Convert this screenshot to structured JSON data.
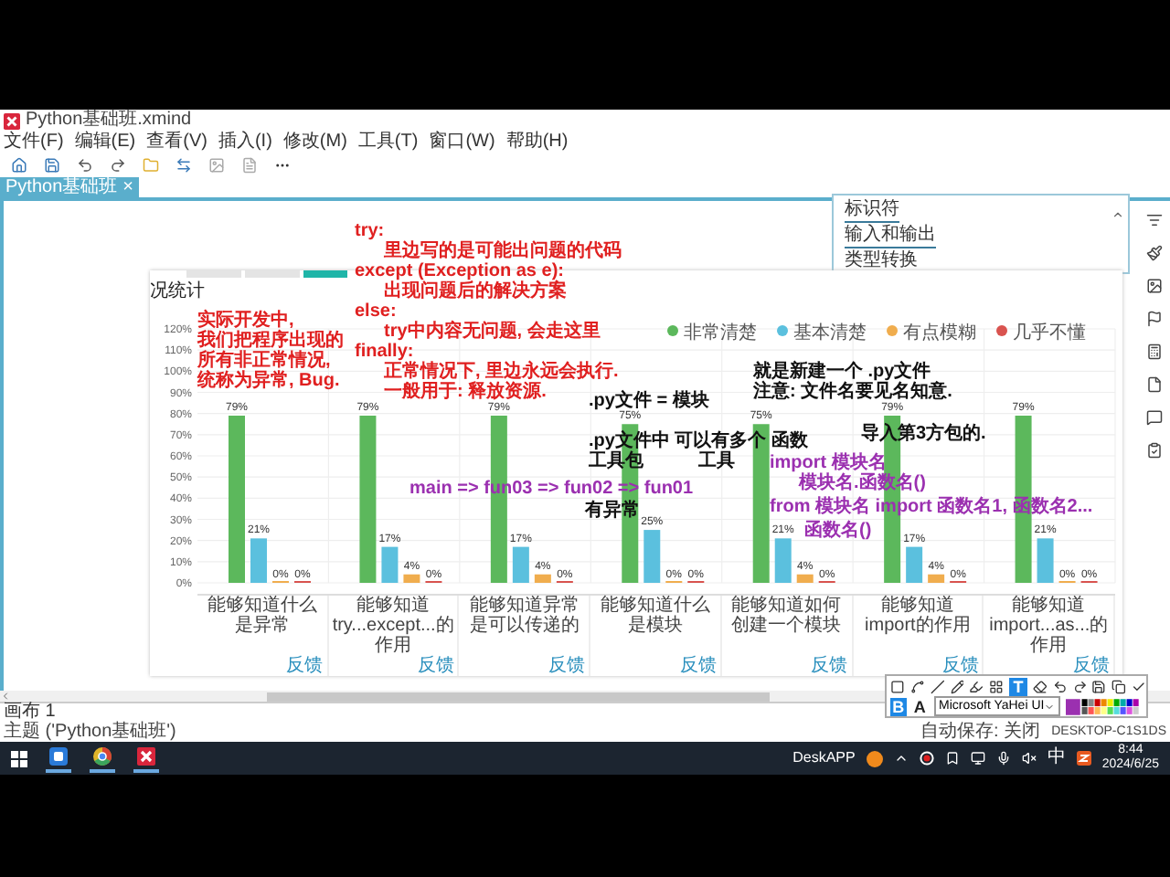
{
  "window": {
    "title": "Python基础班.xmind"
  },
  "menu": [
    "文件(F)",
    "编辑(E)",
    "查看(V)",
    "插入(I)",
    "修改(M)",
    "工具(T)",
    "窗口(W)",
    "帮助(H)"
  ],
  "tabs": [
    {
      "label": "Python基础班",
      "close": "×",
      "selected": true
    }
  ],
  "topics": [
    {
      "label": "标识符"
    },
    {
      "label": "输入和输出"
    },
    {
      "label": "类型转换"
    }
  ],
  "image": {
    "strip_tabs": [
      {
        "selected": false
      },
      {
        "selected": false
      },
      {
        "selected": true
      }
    ],
    "title": "况统计",
    "chart_data": {
      "type": "bar",
      "categories": [
        "能够知道什么是异常",
        "能够知道try...except...的作用",
        "能够知道异常是可以传递的",
        "能够知道什么是模块",
        "能够知道如何创建一个模块",
        "能够知道import的作用",
        "能够知道import...as...的作用"
      ],
      "series": [
        {
          "name": "非常清楚",
          "color": "#5cb85c",
          "values": [
            79,
            79,
            79,
            75,
            75,
            79,
            79
          ],
          "value_labels": [
            "79%",
            "79%",
            "79%",
            "75%",
            "75%",
            "79%",
            "79%"
          ]
        },
        {
          "name": "基本清楚",
          "color": "#5bc0de",
          "values": [
            21,
            17,
            17,
            25,
            21,
            17,
            21
          ],
          "value_labels": [
            "21%",
            "17%",
            "17%",
            "25%",
            "21%",
            "17%",
            "21%"
          ]
        },
        {
          "name": "有点模糊",
          "color": "#f0ad4e",
          "values": [
            0,
            4,
            4,
            0,
            4,
            4,
            0
          ],
          "value_labels": [
            "0%",
            "4%",
            "4%",
            "0%",
            "4%",
            "4%",
            "0%"
          ]
        },
        {
          "name": "几乎不懂",
          "color": "#d9534f",
          "values": [
            0,
            0,
            0,
            0,
            0,
            0,
            0
          ],
          "value_labels": [
            "0%",
            "0%",
            "0%",
            "0%",
            "0%",
            "0%",
            "0%"
          ]
        }
      ],
      "ylim": [
        0,
        120
      ],
      "yticks": [
        {
          "value": 0,
          "label": "0%"
        },
        {
          "value": 10,
          "label": "10%"
        },
        {
          "value": 20,
          "label": "20%"
        },
        {
          "value": 30,
          "label": "30%"
        },
        {
          "value": 40,
          "label": "40%"
        },
        {
          "value": 50,
          "label": "50%"
        },
        {
          "value": 60,
          "label": "60%"
        },
        {
          "value": 70,
          "label": "70%"
        },
        {
          "value": 80,
          "label": "80%"
        },
        {
          "value": 90,
          "label": "90%"
        },
        {
          "value": 100,
          "label": "100%"
        },
        {
          "value": 110,
          "label": "110%"
        },
        {
          "value": 120,
          "label": "120%"
        }
      ],
      "grid": true,
      "legend": true
    },
    "category_links": [
      "反馈",
      "反馈",
      "反馈",
      "反馈",
      "反馈",
      "反馈",
      "反馈"
    ]
  },
  "annotations": [
    {
      "color": "#e02020",
      "lines": [
        {
          "text": "实际开发中,",
          "indented": false
        },
        {
          "text": "我们把程序出现的",
          "indented": false
        },
        {
          "text": "所有非正常情况,",
          "indented": false
        },
        {
          "text": "统称为异常, Bug.",
          "indented": false
        }
      ]
    },
    {
      "color": "#e02020",
      "lines": [
        {
          "text": "try:",
          "indented": false
        },
        {
          "text": "里边写的是可能出问题的代码",
          "indented": true
        },
        {
          "text": "except (Exception as e):",
          "indented": false
        },
        {
          "text": "出现问题后的解决方案",
          "indented": true
        },
        {
          "text": "else:",
          "indented": false
        },
        {
          "text": "try中内容无问题, 会走这里",
          "indented": true
        },
        {
          "text": "finally:",
          "indented": false
        },
        {
          "text": "正常情况下, 里边永远会执行.",
          "indented": true
        },
        {
          "text": "一般用于: 释放资源.",
          "indented": true
        }
      ]
    },
    {
      "color": "#111111",
      "lines": [
        {
          "text": ".py文件 = 模块",
          "indented": false
        }
      ]
    },
    {
      "color": "#111111",
      "lines": [
        {
          "text": "就是新建一个 .py文件",
          "indented": false
        },
        {
          "text": "注意: 文件名要见名知意.",
          "indented": false
        }
      ]
    },
    {
      "color": "#111111",
      "lines": [
        {
          "text": ".py文件中 可以有多个 函数",
          "indented": false
        }
      ]
    },
    {
      "color": "#111111",
      "lines": [
        {
          "text": "导入第3方包的.",
          "indented": false
        }
      ]
    },
    {
      "color": "#111111",
      "lines": [
        {
          "text": "工具包",
          "indented": false
        }
      ]
    },
    {
      "color": "#111111",
      "lines": [
        {
          "text": "工具",
          "indented": false
        }
      ]
    },
    {
      "color": "#9b30b0",
      "lines": [
        {
          "text": "main => fun03 => fun02 => fun01",
          "indented": false
        }
      ]
    },
    {
      "color": "#9b30b0",
      "lines": [
        {
          "text": "import 模块名",
          "indented": false
        },
        {
          "text": "模块名.函数名()",
          "indented": true
        }
      ]
    },
    {
      "color": "#111111",
      "lines": [
        {
          "text": "有异常",
          "indented": false
        }
      ]
    },
    {
      "color": "#9b30b0",
      "lines": [
        {
          "text": "from 模块名 import 函数名1, 函数名2...",
          "indented": false
        }
      ]
    },
    {
      "color": "#9b30b0",
      "lines": [
        {
          "text": "函数名()",
          "indented": false
        }
      ]
    }
  ],
  "sheet_tab": "画布 1",
  "status": {
    "topic": "主题 ('Python基础班')",
    "autosave": "自动保存: 关闭",
    "computer": "DESKTOP-C1S1DS"
  },
  "pen_toolbar": {
    "text_tool": "T",
    "bold": "B",
    "font_color": "A",
    "font": "Microsoft YaHei UI"
  },
  "taskbar": {
    "app_label": "DeskAPP",
    "ime": "中",
    "time": "8:44",
    "date": "2024/6/25"
  }
}
